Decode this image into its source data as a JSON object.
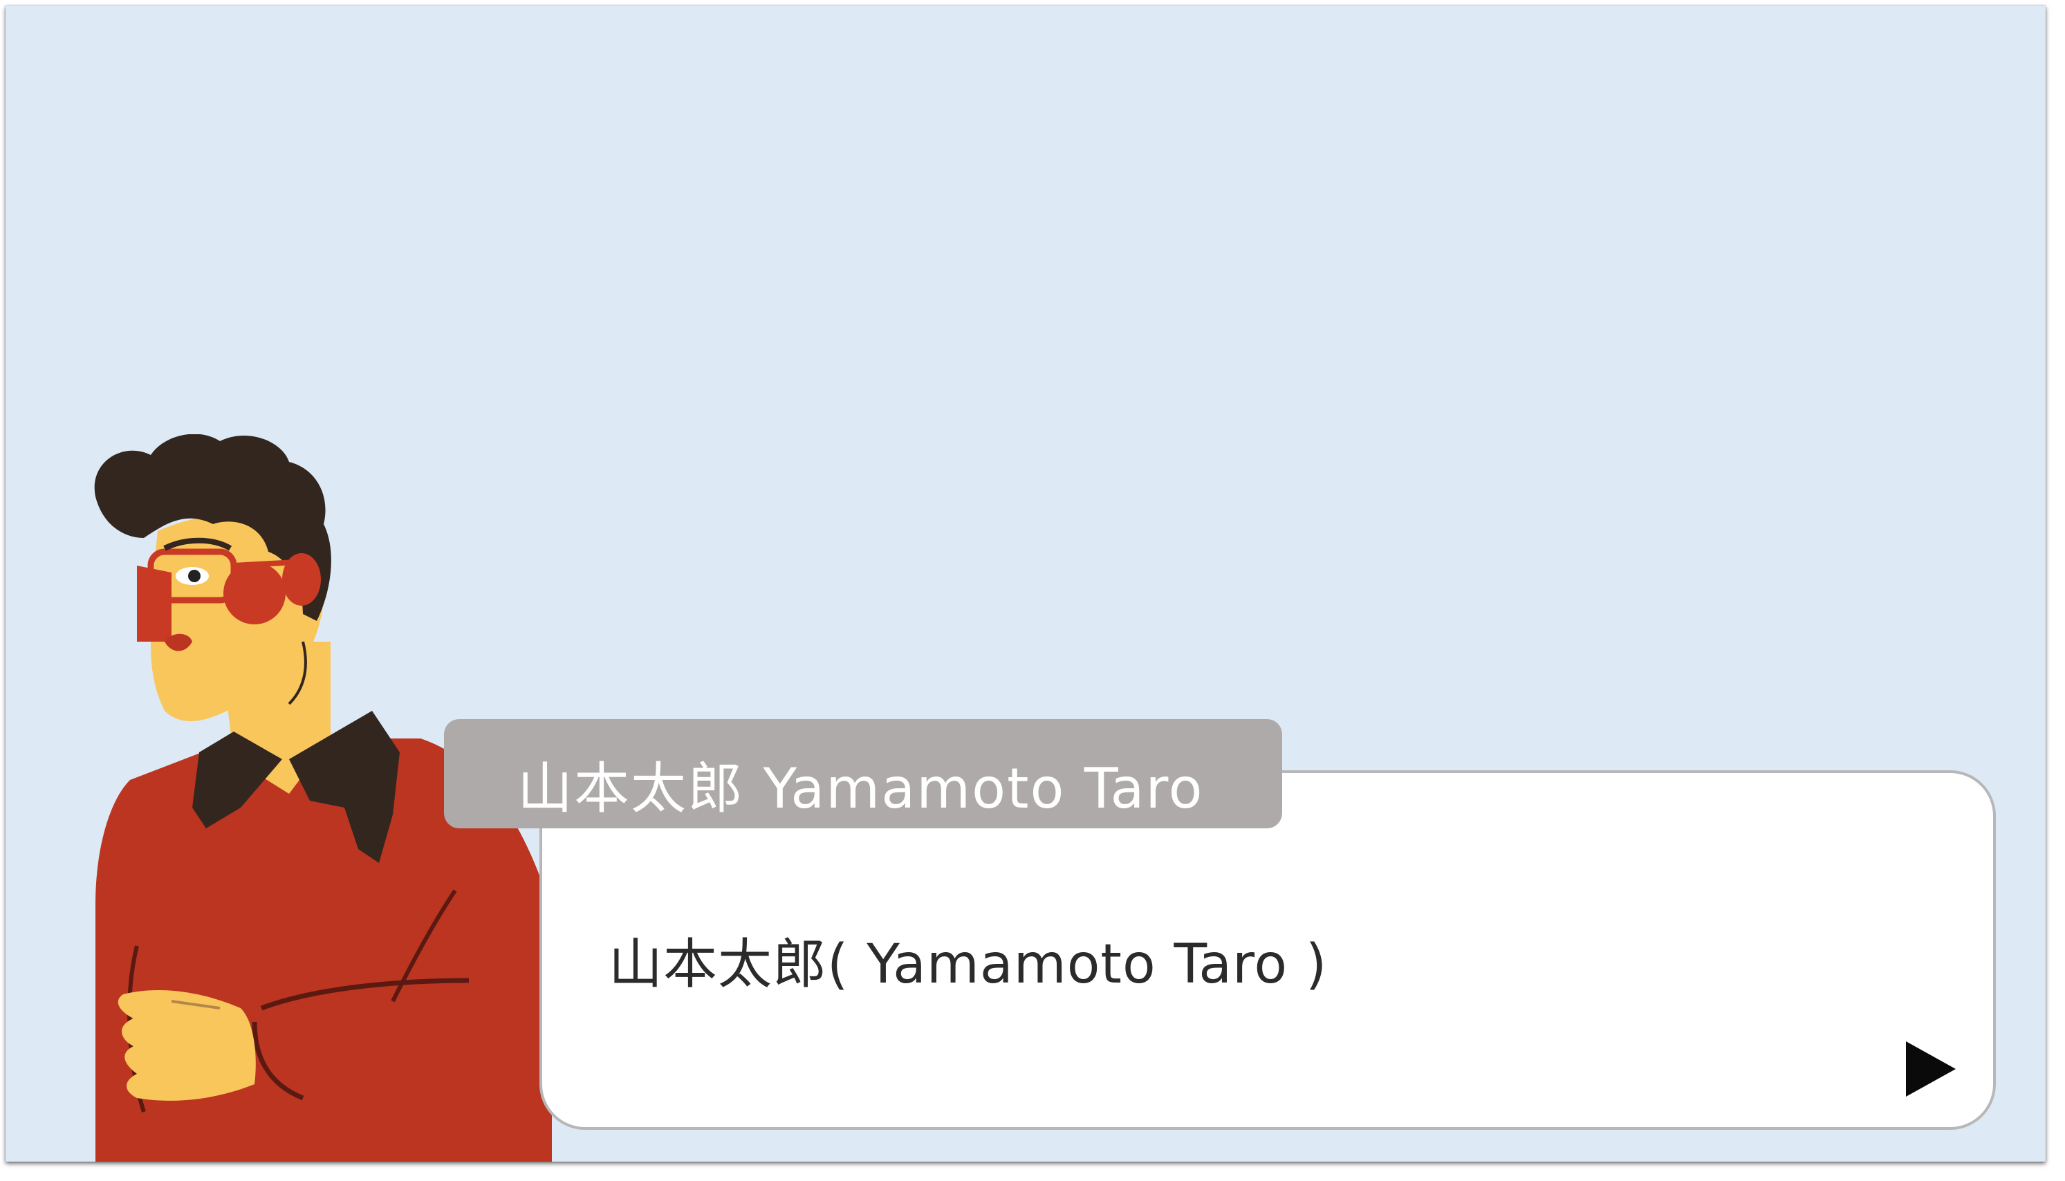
{
  "scene": {
    "background_color": "#dde9f5"
  },
  "character": {
    "name_label": "山本太郎  Yamamoto Taro",
    "sweater_color": "#bb3520",
    "skin_color": "#f9c65b",
    "hair_color": "#33261f",
    "glasses_color": "#c93a24"
  },
  "dialog": {
    "text": "山本太郎( Yamamoto Taro )",
    "advance_icon": "play-triangle-icon"
  }
}
